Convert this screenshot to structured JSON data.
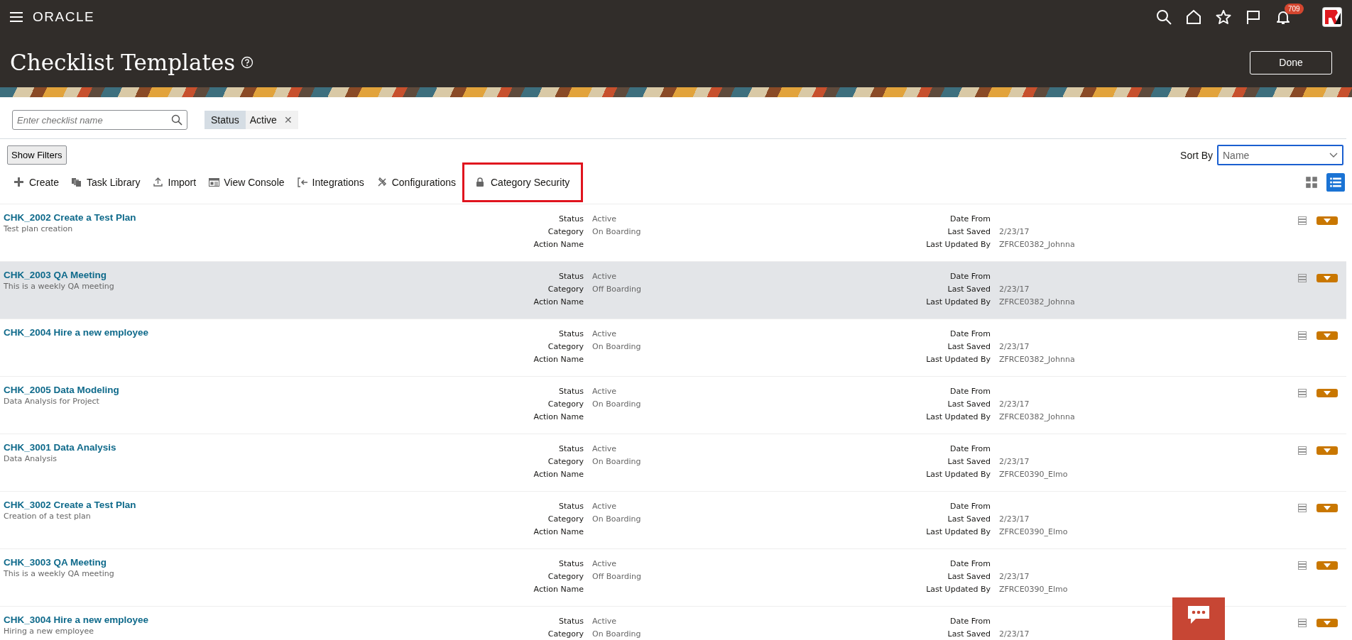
{
  "header": {
    "brand": "ORACLE",
    "notification_count": "709",
    "title": "Checklist Templates",
    "done_button": "Done"
  },
  "search": {
    "placeholder": "Enter checklist name"
  },
  "filter_chip": {
    "label": "Status",
    "value": "Active",
    "remove": "✕"
  },
  "show_filters": "Show Filters",
  "sort": {
    "label": "Sort By",
    "value": "Name"
  },
  "toolbar": [
    {
      "kind": "create",
      "label": "Create",
      "highlighted": false
    },
    {
      "kind": "library",
      "label": "Task Library",
      "highlighted": false
    },
    {
      "kind": "import",
      "label": "Import",
      "highlighted": false
    },
    {
      "kind": "console",
      "label": "View Console",
      "highlighted": false
    },
    {
      "kind": "integrations",
      "label": "Integrations",
      "highlighted": false
    },
    {
      "kind": "configurations",
      "label": "Configurations",
      "highlighted": false
    },
    {
      "kind": "security",
      "label": "Category Security",
      "highlighted": true
    }
  ],
  "views": [
    {
      "kind": "grid",
      "selected": false
    },
    {
      "kind": "list",
      "selected": true
    }
  ],
  "rows": [
    {
      "title": "CHK_2002 Create a Test Plan",
      "description": "Test plan creation",
      "selected": false,
      "fields_left": [
        {
          "label": "Status",
          "value": "Active"
        },
        {
          "label": "Category",
          "value": "On Boarding"
        },
        {
          "label": "Action Name"
        }
      ],
      "fields_right": [
        {
          "label": "Date From"
        },
        {
          "label": "Last Saved",
          "value": "2/23/17"
        },
        {
          "label": "Last Updated By",
          "value": "ZFRCE0382_Johnna"
        }
      ]
    },
    {
      "title": "CHK_2003 QA Meeting",
      "description": "This is a weekly QA meeting",
      "selected": true,
      "fields_left": [
        {
          "label": "Status",
          "value": "Active"
        },
        {
          "label": "Category",
          "value": "Off Boarding"
        },
        {
          "label": "Action Name"
        }
      ],
      "fields_right": [
        {
          "label": "Date From"
        },
        {
          "label": "Last Saved",
          "value": "2/23/17"
        },
        {
          "label": "Last Updated By",
          "value": "ZFRCE0382_Johnna"
        }
      ]
    },
    {
      "title": "CHK_2004 Hire a new employee",
      "selected": false,
      "fields_left": [
        {
          "label": "Status",
          "value": "Active"
        },
        {
          "label": "Category",
          "value": "On Boarding"
        },
        {
          "label": "Action Name"
        }
      ],
      "fields_right": [
        {
          "label": "Date From"
        },
        {
          "label": "Last Saved",
          "value": "2/23/17"
        },
        {
          "label": "Last Updated By",
          "value": "ZFRCE0382_Johnna"
        }
      ]
    },
    {
      "title": "CHK_2005 Data Modeling",
      "description": "Data Analysis for Project",
      "selected": false,
      "fields_left": [
        {
          "label": "Status",
          "value": "Active"
        },
        {
          "label": "Category",
          "value": "On Boarding"
        },
        {
          "label": "Action Name"
        }
      ],
      "fields_right": [
        {
          "label": "Date From"
        },
        {
          "label": "Last Saved",
          "value": "2/23/17"
        },
        {
          "label": "Last Updated By",
          "value": "ZFRCE0382_Johnna"
        }
      ]
    },
    {
      "title": "CHK_3001 Data Analysis",
      "description": "Data Analysis",
      "selected": false,
      "fields_left": [
        {
          "label": "Status",
          "value": "Active"
        },
        {
          "label": "Category",
          "value": "On Boarding"
        },
        {
          "label": "Action Name"
        }
      ],
      "fields_right": [
        {
          "label": "Date From"
        },
        {
          "label": "Last Saved",
          "value": "2/23/17"
        },
        {
          "label": "Last Updated By",
          "value": "ZFRCE0390_Elmo"
        }
      ]
    },
    {
      "title": "CHK_3002 Create a Test Plan",
      "description": "Creation of a test plan",
      "selected": false,
      "fields_left": [
        {
          "label": "Status",
          "value": "Active"
        },
        {
          "label": "Category",
          "value": "On Boarding"
        },
        {
          "label": "Action Name"
        }
      ],
      "fields_right": [
        {
          "label": "Date From"
        },
        {
          "label": "Last Saved",
          "value": "2/23/17"
        },
        {
          "label": "Last Updated By",
          "value": "ZFRCE0390_Elmo"
        }
      ]
    },
    {
      "title": "CHK_3003 QA Meeting",
      "description": "This is a weekly QA meeting",
      "selected": false,
      "fields_left": [
        {
          "label": "Status",
          "value": "Active"
        },
        {
          "label": "Category",
          "value": "Off Boarding"
        },
        {
          "label": "Action Name"
        }
      ],
      "fields_right": [
        {
          "label": "Date From"
        },
        {
          "label": "Last Saved",
          "value": "2/23/17"
        },
        {
          "label": "Last Updated By",
          "value": "ZFRCE0390_Elmo"
        }
      ]
    },
    {
      "title": "CHK_3004 Hire a new employee",
      "description": "Hiring a new employee",
      "selected": false,
      "fields_left": [
        {
          "label": "Status",
          "value": "Active"
        },
        {
          "label": "Category",
          "value": "On Boarding"
        }
      ],
      "fields_right": [
        {
          "label": "Date From"
        },
        {
          "label": "Last Saved",
          "value": "2/23/17"
        }
      ]
    }
  ]
}
